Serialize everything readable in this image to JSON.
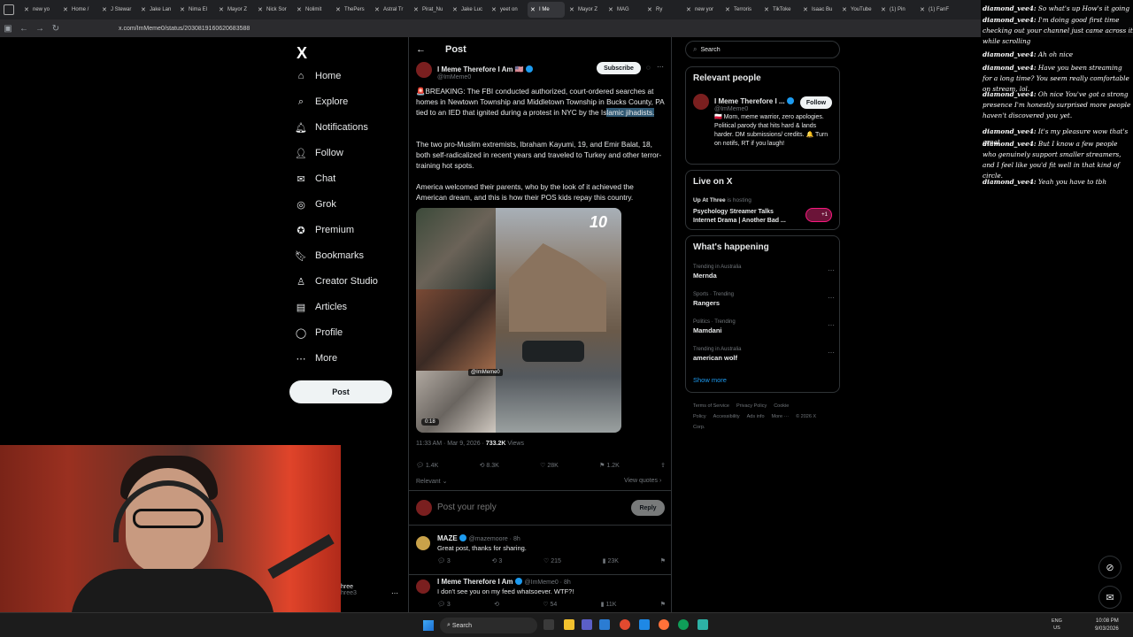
{
  "browser": {
    "tabs": [
      "new yo",
      "Home /",
      "J Stewar",
      "Jake Lan",
      "Nima El",
      "Mayor Z",
      "Nick Sor",
      "Nolimit",
      "ThePers",
      "Astral Tr",
      "Pirat_Nu",
      "Jake Luc",
      "yeet on",
      "I Me",
      "Mayor Z",
      "MAG",
      "Ry",
      "new yor",
      "Terroris",
      "TikToke",
      "Isaac Bu",
      "YouTube",
      "(1) Pin",
      "(1) FanF"
    ],
    "active_tab_index": 13,
    "url": "x.com/ImMeme0/status/2030819160620683588"
  },
  "nav": {
    "logo": "X",
    "items": [
      {
        "label": "Home",
        "icon": "⌂",
        "name": "home"
      },
      {
        "label": "Explore",
        "icon": "⌕",
        "name": "explore"
      },
      {
        "label": "Notifications",
        "icon": "🔔︎",
        "name": "notifications"
      },
      {
        "label": "Follow",
        "icon": "👤︎",
        "name": "follow"
      },
      {
        "label": "Chat",
        "icon": "✉",
        "name": "chat"
      },
      {
        "label": "Grok",
        "icon": "◎",
        "name": "grok"
      },
      {
        "label": "Premium",
        "icon": "✪",
        "name": "premium"
      },
      {
        "label": "Bookmarks",
        "icon": "🔖︎",
        "name": "bookmarks"
      },
      {
        "label": "Creator Studio",
        "icon": "♙",
        "name": "creator-studio"
      },
      {
        "label": "Articles",
        "icon": "▤",
        "name": "articles"
      },
      {
        "label": "Profile",
        "icon": "◯",
        "name": "profile"
      },
      {
        "label": "More",
        "icon": "⋯",
        "name": "more"
      }
    ],
    "post_button": "Post"
  },
  "post": {
    "header_title": "Post",
    "author_name": "I Meme Therefore I Am 🇺🇸",
    "author_handle": "@ImMeme0",
    "subscribe_label": "Subscribe",
    "para1_prefix": "🚨BREAKING: The FBI conducted authorized, court-ordered searches at homes in Newtown Township and Middletown Township in Bucks County, PA tied to an IED that ignited during a protest in NYC by the Is",
    "para1_highlight": "lamic jihadists.",
    "para2": "The two pro-Muslim extremists, Ibraham Kayumi, 19, and Emir Balat, 18, both self-radicalized in recent years and traveled to Turkey and other terror-training hot spots.",
    "para3": "America welcomed their parents, who by the look of it achieved the American dream, and this is how their POS kids repay this country.",
    "media_watermark": "@ImMeme0",
    "media_duration": "0:18",
    "media_logo": "10",
    "timestamp": "11:33 AM · Mar 9, 2026 ·",
    "views_count": "733.2K",
    "views_label": "Views",
    "stats": {
      "replies": "1.4K",
      "reposts": "8.3K",
      "likes": "28K",
      "bookmarks": "1.2K"
    },
    "relevant_label": "Relevant ⌄",
    "view_quotes": "View quotes ›",
    "reply_placeholder": "Post your reply",
    "reply_button": "Reply"
  },
  "replies": [
    {
      "name": "MAZE",
      "handle": "@mazemoore · 8h",
      "text": "Great post, thanks for sharing.",
      "replies": "3",
      "reposts": "3",
      "likes": "215",
      "views": "23K"
    },
    {
      "name": "I Meme Therefore I Am",
      "handle": "@ImMeme0 · 8h",
      "text": "I don't see you on my feed whatsoever. WTF?!",
      "replies": "3",
      "reposts": "",
      "likes": "54",
      "views": "11K"
    }
  ],
  "right": {
    "search_placeholder": "Search",
    "relevant_title": "Relevant people",
    "rel_name": "I Meme Therefore I ...",
    "rel_handle": "@ImMeme0",
    "follow_label": "Follow",
    "rel_bio": "🇵🇱 Mom, meme warrior, zero apologies. Political parody that hits hard & lands harder. DM submissions/ credits. 🔔 Turn on notifs, RT if you laugh!",
    "live_title": "Live on X",
    "live_host": "Up At Three",
    "live_hosting": "is hosting",
    "live_stream_title": "Psychology Streamer Talks Internet Drama | Another Bad ...",
    "live_badge": "+1",
    "happening_title": "What's happening",
    "trends": [
      {
        "context": "Trending in Australia",
        "topic": "Mernda"
      },
      {
        "context": "Sports · Trending",
        "topic": "Rangers"
      },
      {
        "context": "Politics · Trending",
        "topic": "Mamdani"
      },
      {
        "context": "Trending in Australia",
        "topic": "american wolf"
      }
    ],
    "show_more": "Show more",
    "footer": [
      "Terms of Service",
      "Privacy Policy",
      "Cookie Policy",
      "Accessibility",
      "Ads info",
      "More ···",
      "© 2026 X Corp."
    ]
  },
  "chat": [
    {
      "user": "diamond_vee4:",
      "msg": "So what's up How's it going"
    },
    {
      "user": "diamond_vee4:",
      "msg": "I'm doing good first time checking out your channel just came across it while scrolling"
    },
    {
      "user": "diamond_vee4:",
      "msg": "Ah oh nice"
    },
    {
      "user": "diamond_vee4:",
      "msg": "Have you been streaming for a long time? You seem really comfortable on stream, lol."
    },
    {
      "user": "diamond_vee4:",
      "msg": "Oh nice You've got a strong presence I'm honestly surprised more people haven't discovered you yet."
    },
    {
      "user": "diamond_vee4:",
      "msg": "It's my pleasure wow that's great"
    },
    {
      "user": "diamond_vee4:",
      "msg": "But I know a few people who genuinely support smaller streamers, and I feel like you'd fit well in that kind of circle."
    },
    {
      "user": "diamond_vee4:",
      "msg": "Yeah you have to tbh"
    }
  ],
  "bottom_profile": {
    "name": "hree",
    "handle": "hree3"
  },
  "taskbar": {
    "search_label": "Search",
    "lang_top": "ENG",
    "lang_bottom": "US",
    "time": "10:08 PM",
    "date": "9/03/2026"
  }
}
